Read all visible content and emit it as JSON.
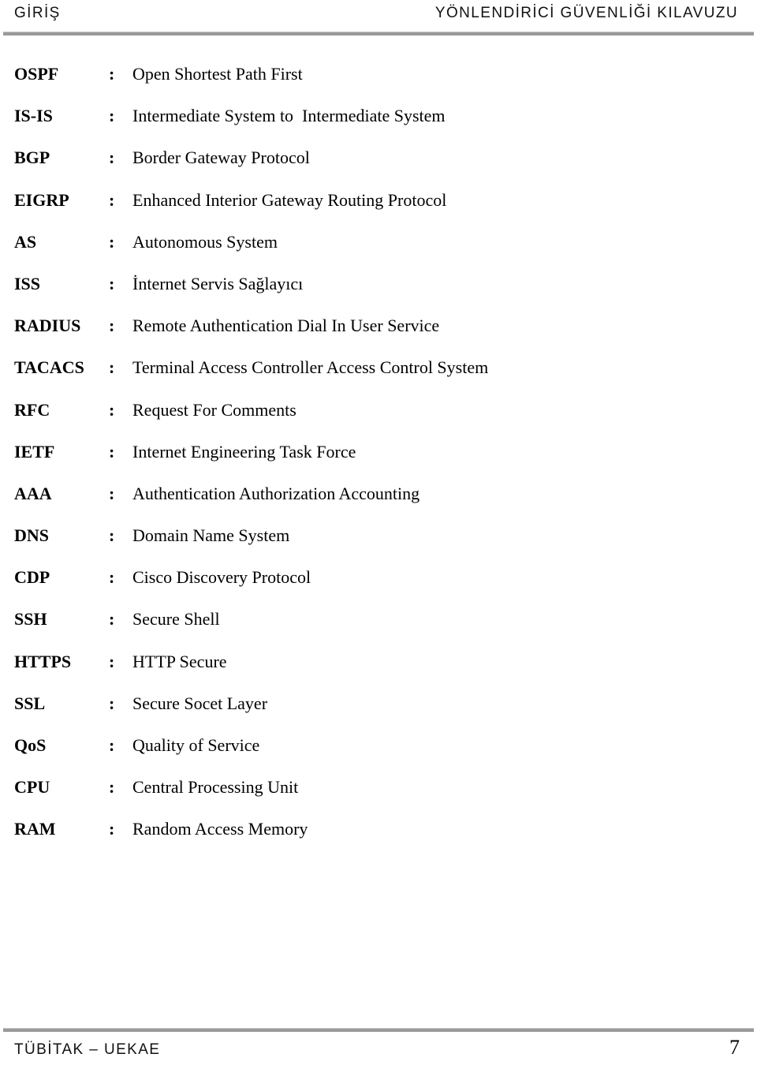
{
  "header": {
    "section": "GİRİŞ",
    "title": "YÖNLENDİRİCİ GÜVENLİĞİ KILAVUZU"
  },
  "abbreviations": {
    "separator": ":",
    "rows": [
      {
        "term": "OSPF",
        "definition": "Open Shortest Path First"
      },
      {
        "term": "IS-IS",
        "definition": "Intermediate System to  Intermediate System"
      },
      {
        "term": "BGP",
        "definition": "Border Gateway Protocol"
      },
      {
        "term": "EIGRP",
        "definition": "Enhanced Interior Gateway Routing Protocol"
      },
      {
        "term": "AS",
        "definition": "Autonomous System"
      },
      {
        "term": "ISS",
        "definition": "İnternet Servis Sağlayıcı"
      },
      {
        "term": "RADIUS",
        "definition": "Remote Authentication Dial In User Service"
      },
      {
        "term": "TACACS",
        "definition": "Terminal Access Controller Access Control System"
      },
      {
        "term": "RFC",
        "definition": "Request For Comments"
      },
      {
        "term": "IETF",
        "definition": "Internet Engineering Task Force"
      },
      {
        "term": "AAA",
        "definition": "Authentication Authorization Accounting"
      },
      {
        "term": "DNS",
        "definition": "Domain Name System"
      },
      {
        "term": "CDP",
        "definition": "Cisco Discovery Protocol"
      },
      {
        "term": "SSH",
        "definition": "Secure Shell"
      },
      {
        "term": "HTTPS",
        "definition": "HTTP Secure"
      },
      {
        "term": "SSL",
        "definition": "Secure Socet Layer"
      },
      {
        "term": "QoS",
        "definition": "Quality of Service"
      },
      {
        "term": "CPU",
        "definition": "Central Processing Unit"
      },
      {
        "term": "RAM",
        "definition": "Random Access Memory"
      }
    ]
  },
  "footer": {
    "organization": "TÜBİTAK – UEKAE",
    "page_number": "7"
  },
  "colors": {
    "text": "#000000",
    "header_text": "#111111",
    "rule": "#9a9a9a",
    "rule_highlight": "#c9c9c9",
    "page_background": "#ffffff"
  }
}
